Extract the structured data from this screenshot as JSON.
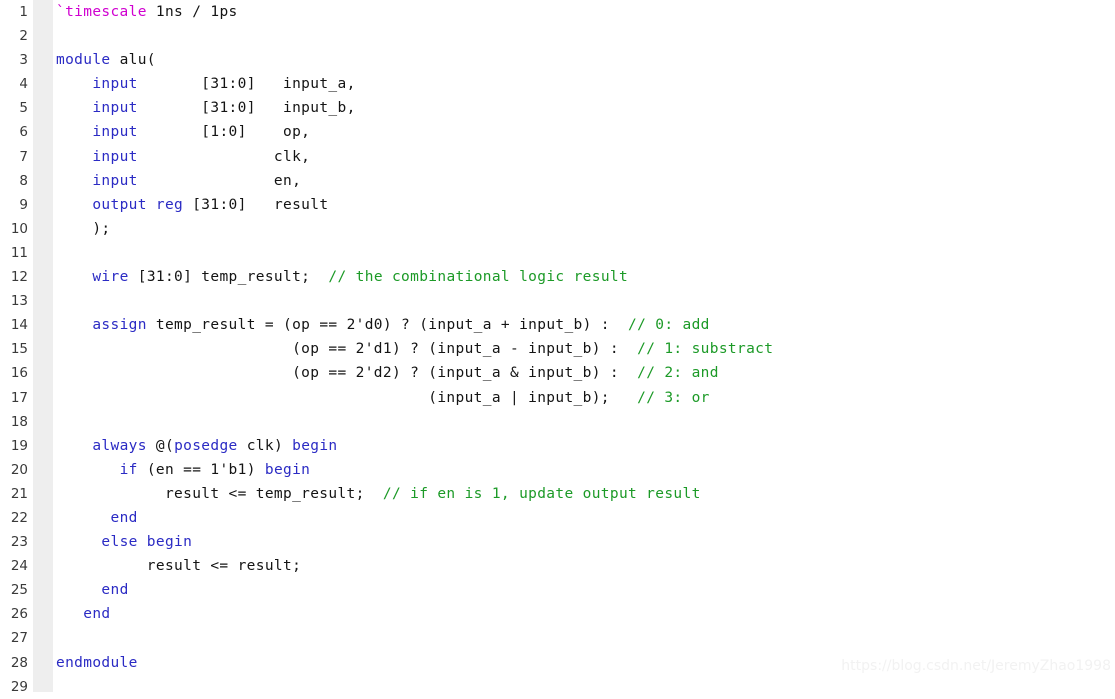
{
  "editor": {
    "language": "Verilog",
    "gutter_start": 1,
    "gutter_end": 29,
    "colors": {
      "background": "#ffffff",
      "gutter_band": "#eeeeee",
      "keyword": "#2b2bc4",
      "comment": "#1c9a27",
      "directive": "#d000d0",
      "plain": "#141414",
      "line_number": "#3a3a3a",
      "watermark": "#f2f2f2"
    }
  },
  "watermark": {
    "text": "https://blog.csdn.net/JeremyZhao1998"
  },
  "code": {
    "lines": [
      {
        "n": "1",
        "tokens": [
          {
            "t": "`timescale",
            "c": "dir"
          },
          {
            "t": " 1ns / 1ps",
            "c": "pl"
          }
        ]
      },
      {
        "n": "2",
        "tokens": []
      },
      {
        "n": "3",
        "tokens": [
          {
            "t": "module",
            "c": "kw"
          },
          {
            "t": " alu(",
            "c": "pl"
          }
        ]
      },
      {
        "n": "4",
        "tokens": [
          {
            "t": "    ",
            "c": "pl"
          },
          {
            "t": "input",
            "c": "kw"
          },
          {
            "t": "       [31:0]   input_a,",
            "c": "pl"
          }
        ]
      },
      {
        "n": "5",
        "tokens": [
          {
            "t": "    ",
            "c": "pl"
          },
          {
            "t": "input",
            "c": "kw"
          },
          {
            "t": "       [31:0]   input_b,",
            "c": "pl"
          }
        ]
      },
      {
        "n": "6",
        "tokens": [
          {
            "t": "    ",
            "c": "pl"
          },
          {
            "t": "input",
            "c": "kw"
          },
          {
            "t": "       [1:0]    op,",
            "c": "pl"
          }
        ]
      },
      {
        "n": "7",
        "tokens": [
          {
            "t": "    ",
            "c": "pl"
          },
          {
            "t": "input",
            "c": "kw"
          },
          {
            "t": "               clk,",
            "c": "pl"
          }
        ]
      },
      {
        "n": "8",
        "tokens": [
          {
            "t": "    ",
            "c": "pl"
          },
          {
            "t": "input",
            "c": "kw"
          },
          {
            "t": "               en,",
            "c": "pl"
          }
        ]
      },
      {
        "n": "9",
        "tokens": [
          {
            "t": "    ",
            "c": "pl"
          },
          {
            "t": "output reg",
            "c": "kw"
          },
          {
            "t": " [31:0]   result",
            "c": "pl"
          }
        ]
      },
      {
        "n": "10",
        "tokens": [
          {
            "t": "    );",
            "c": "pl"
          }
        ]
      },
      {
        "n": "11",
        "tokens": []
      },
      {
        "n": "12",
        "tokens": [
          {
            "t": "    ",
            "c": "pl"
          },
          {
            "t": "wire",
            "c": "kw"
          },
          {
            "t": " [31:0] temp_result;  ",
            "c": "pl"
          },
          {
            "t": "// the combinational logic result",
            "c": "cm"
          }
        ]
      },
      {
        "n": "13",
        "tokens": []
      },
      {
        "n": "14",
        "tokens": [
          {
            "t": "    ",
            "c": "pl"
          },
          {
            "t": "assign",
            "c": "kw"
          },
          {
            "t": " temp_result = (op == 2'd0) ? (input_a + input_b) :  ",
            "c": "pl"
          },
          {
            "t": "// 0: add",
            "c": "cm"
          }
        ]
      },
      {
        "n": "15",
        "tokens": [
          {
            "t": "                          (op == 2'd1) ? (input_a - input_b) :  ",
            "c": "pl"
          },
          {
            "t": "// 1: substract",
            "c": "cm"
          }
        ]
      },
      {
        "n": "16",
        "tokens": [
          {
            "t": "                          (op == 2'd2) ? (input_a & input_b) :  ",
            "c": "pl"
          },
          {
            "t": "// 2: and",
            "c": "cm"
          }
        ]
      },
      {
        "n": "17",
        "tokens": [
          {
            "t": "                                         (input_a | input_b);   ",
            "c": "pl"
          },
          {
            "t": "// 3: or",
            "c": "cm"
          }
        ]
      },
      {
        "n": "18",
        "tokens": []
      },
      {
        "n": "19",
        "tokens": [
          {
            "t": "    ",
            "c": "pl"
          },
          {
            "t": "always",
            "c": "kw"
          },
          {
            "t": " @(",
            "c": "pl"
          },
          {
            "t": "posedge",
            "c": "kw"
          },
          {
            "t": " clk) ",
            "c": "pl"
          },
          {
            "t": "begin",
            "c": "kw"
          }
        ]
      },
      {
        "n": "20",
        "tokens": [
          {
            "t": "       ",
            "c": "pl"
          },
          {
            "t": "if",
            "c": "kw"
          },
          {
            "t": " (en == 1'b1) ",
            "c": "pl"
          },
          {
            "t": "begin",
            "c": "kw"
          }
        ]
      },
      {
        "n": "21",
        "tokens": [
          {
            "t": "            result <= temp_result;  ",
            "c": "pl"
          },
          {
            "t": "// if en is 1, update output result",
            "c": "cm"
          }
        ]
      },
      {
        "n": "22",
        "tokens": [
          {
            "t": "      ",
            "c": "pl"
          },
          {
            "t": "end",
            "c": "kw"
          }
        ]
      },
      {
        "n": "23",
        "tokens": [
          {
            "t": "     ",
            "c": "pl"
          },
          {
            "t": "else begin",
            "c": "kw"
          }
        ]
      },
      {
        "n": "24",
        "tokens": [
          {
            "t": "          result <= result;",
            "c": "pl"
          }
        ]
      },
      {
        "n": "25",
        "tokens": [
          {
            "t": "     ",
            "c": "pl"
          },
          {
            "t": "end",
            "c": "kw"
          }
        ]
      },
      {
        "n": "26",
        "tokens": [
          {
            "t": "   ",
            "c": "pl"
          },
          {
            "t": "end",
            "c": "kw"
          }
        ]
      },
      {
        "n": "27",
        "tokens": []
      },
      {
        "n": "28",
        "tokens": [
          {
            "t": "endmodule",
            "c": "kw"
          }
        ]
      },
      {
        "n": "29",
        "tokens": []
      }
    ]
  }
}
